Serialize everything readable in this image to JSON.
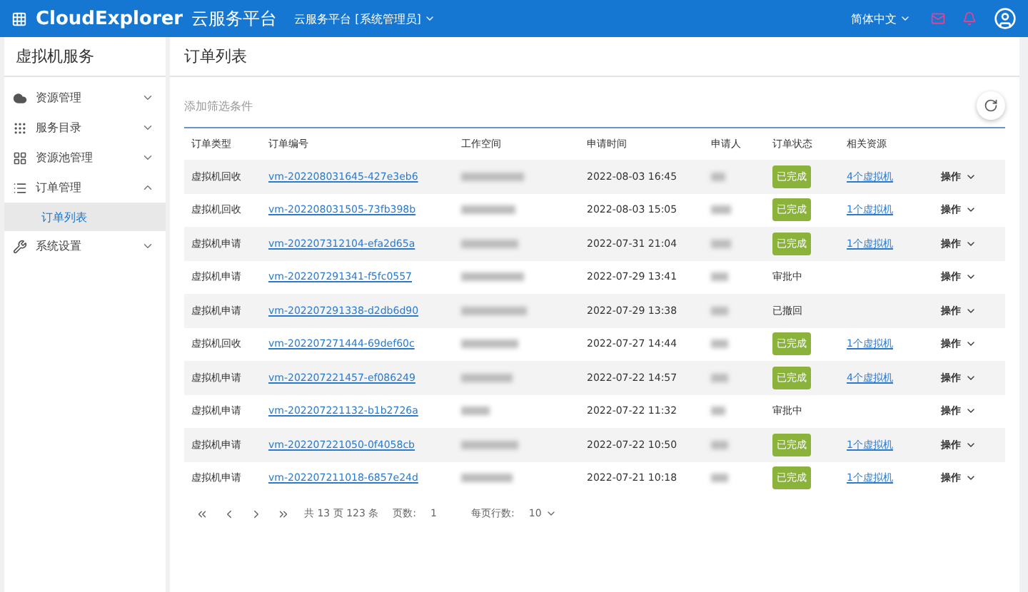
{
  "header": {
    "brand": "CloudExplorer",
    "platform": "云服务平台",
    "tenant": "云服务平台 [系统管理员]",
    "language": "简体中文"
  },
  "sidebar": {
    "title": "虚拟机服务",
    "items": [
      {
        "label": "资源管理",
        "expanded": false
      },
      {
        "label": "服务目录",
        "expanded": false
      },
      {
        "label": "资源池管理",
        "expanded": false
      },
      {
        "label": "订单管理",
        "expanded": true,
        "children": [
          {
            "label": "订单列表",
            "selected": true
          }
        ]
      },
      {
        "label": "系统设置",
        "expanded": false
      }
    ]
  },
  "page_title": "订单列表",
  "filter": {
    "placeholder": "添加筛选条件"
  },
  "table": {
    "columns": [
      "订单类型",
      "订单编号",
      "工作空间",
      "申请时间",
      "申请人",
      "订单状态",
      "相关资源"
    ],
    "rows": [
      {
        "type": "虚拟机回收",
        "order_no": "vm-202208031645-427e3eb6",
        "time": "2022-08-03 16:45",
        "status": "已完成",
        "kind": "done",
        "resource": "4个虚拟机",
        "action": "操作"
      },
      {
        "type": "虚拟机回收",
        "order_no": "vm-202208031505-73fb398b",
        "time": "2022-08-03 15:05",
        "status": "已完成",
        "kind": "done",
        "resource": "1个虚拟机",
        "action": "操作"
      },
      {
        "type": "虚拟机申请",
        "order_no": "vm-202207312104-efa2d65a",
        "time": "2022-07-31 21:04",
        "status": "已完成",
        "kind": "done",
        "resource": "1个虚拟机",
        "action": "操作"
      },
      {
        "type": "虚拟机申请",
        "order_no": "vm-202207291341-f5fc0557",
        "time": "2022-07-29 13:41",
        "status": "审批中",
        "kind": "plain",
        "action": "操作"
      },
      {
        "type": "虚拟机申请",
        "order_no": "vm-202207291338-d2db6d90",
        "time": "2022-07-29 13:38",
        "status": "已撤回",
        "kind": "plain",
        "action": "操作"
      },
      {
        "type": "虚拟机回收",
        "order_no": "vm-202207271444-69def60c",
        "time": "2022-07-27 14:44",
        "status": "已完成",
        "kind": "done",
        "resource": "1个虚拟机",
        "action": "操作"
      },
      {
        "type": "虚拟机申请",
        "order_no": "vm-202207221457-ef086249",
        "time": "2022-07-22 14:57",
        "status": "已完成",
        "kind": "done",
        "resource": "4个虚拟机",
        "action": "操作"
      },
      {
        "type": "虚拟机申请",
        "order_no": "vm-202207221132-b1b2726a",
        "time": "2022-07-22 11:32",
        "status": "审批中",
        "kind": "plain",
        "action": "操作"
      },
      {
        "type": "虚拟机申请",
        "order_no": "vm-202207221050-0f4058cb",
        "time": "2022-07-22 10:50",
        "status": "已完成",
        "kind": "done",
        "resource": "1个虚拟机",
        "action": "操作"
      },
      {
        "type": "虚拟机申请",
        "order_no": "vm-202207211018-6857e24d",
        "time": "2022-07-21 10:18",
        "status": "已完成",
        "kind": "done",
        "resource": "1个虚拟机",
        "action": "操作"
      }
    ]
  },
  "pagination": {
    "summary": "共 13 页 123 条",
    "page_label": "页数:",
    "page": "1",
    "per_page_label": "每页行数:",
    "per_page": "10"
  }
}
